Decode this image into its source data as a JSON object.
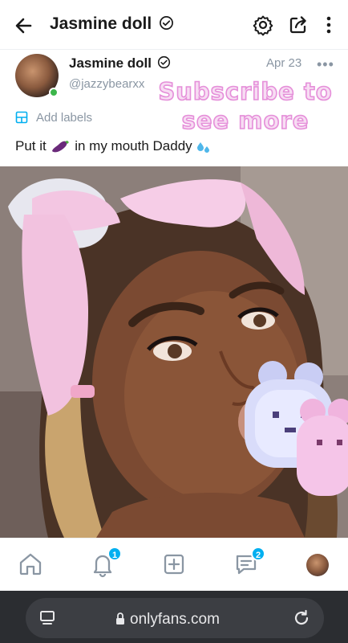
{
  "header": {
    "title": "Jasmine doll",
    "icons": [
      "back-arrow-icon",
      "verified-icon",
      "settings-icon",
      "share-icon",
      "more-vertical-icon"
    ]
  },
  "post": {
    "author": "Jasmine doll",
    "handle": "@jazzybearxx",
    "date": "Apr 23",
    "more": "•••",
    "promo_line1": "Subscribe to",
    "promo_line2": "see more",
    "add_labels": "Add labels",
    "caption_part1": "Put it ",
    "caption_part2": " in my mouth Daddy",
    "caption_emojis": [
      "eggplant",
      "sweat-droplets"
    ]
  },
  "bottom_nav": {
    "items": [
      "home",
      "notifications",
      "add-post",
      "messages",
      "profile"
    ],
    "notifications_count": "1",
    "messages_count": "2"
  },
  "browser": {
    "url": "onlyfans.com"
  },
  "colors": {
    "accent": "#00aff0",
    "muted": "#8a96a3",
    "online": "#3bb54a",
    "promo_fill": "#f7ddf3",
    "promo_stroke": "#e58fd9"
  }
}
